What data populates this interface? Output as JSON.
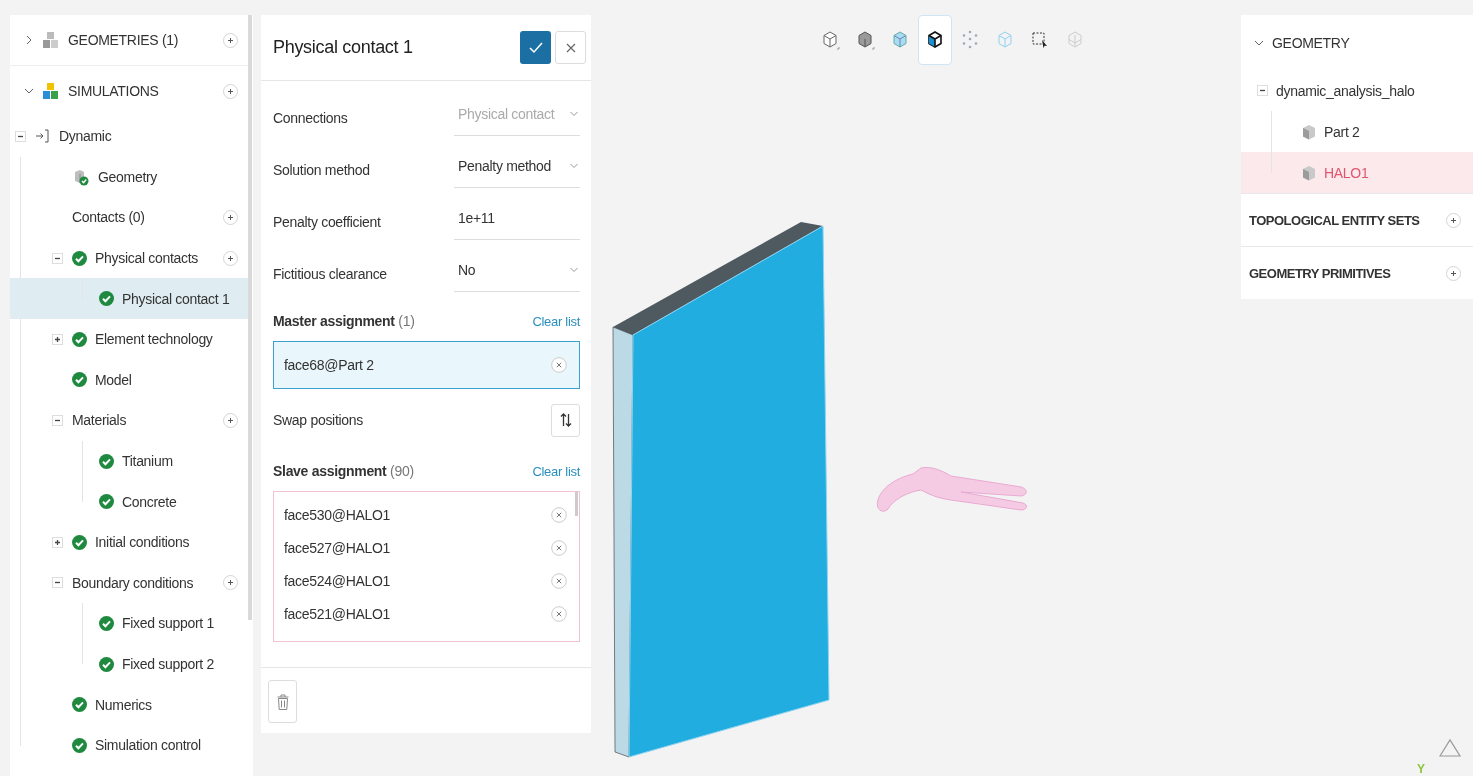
{
  "sidebar": {
    "sections": [
      {
        "label": "GEOMETRIES (1)",
        "kind": "geometries",
        "expanded": false,
        "add": true
      },
      {
        "label": "SIMULATIONS",
        "kind": "simulations",
        "expanded": true,
        "add": true,
        "children": [
          {
            "label": "Dynamic",
            "kind": "simulation",
            "expanded": true,
            "add": false,
            "selected": false,
            "children": [
              {
                "label": "Geometry",
                "kind": "geometry",
                "add": false,
                "selected": false
              },
              {
                "label": "Contacts (0)",
                "kind": "plain",
                "add": true,
                "selected": false
              },
              {
                "label": "Physical contacts",
                "kind": "check",
                "expanded": true,
                "add": true,
                "selected": false,
                "children": [
                  {
                    "label": "Physical contact 1",
                    "kind": "check",
                    "add": false,
                    "selected": true
                  }
                ]
              },
              {
                "label": "Element technology",
                "kind": "check",
                "expanded": false,
                "add": false,
                "selected": false
              },
              {
                "label": "Model",
                "kind": "check",
                "add": false,
                "selected": false
              },
              {
                "label": "Materials",
                "kind": "plain",
                "expanded": true,
                "add": true,
                "selected": false,
                "children": [
                  {
                    "label": "Titanium",
                    "kind": "check",
                    "add": false,
                    "selected": false
                  },
                  {
                    "label": "Concrete",
                    "kind": "check",
                    "add": false,
                    "selected": false
                  }
                ]
              },
              {
                "label": "Initial conditions",
                "kind": "check",
                "expanded": false,
                "add": false,
                "selected": false
              },
              {
                "label": "Boundary conditions",
                "kind": "plain",
                "expanded": true,
                "add": true,
                "selected": false,
                "children": [
                  {
                    "label": "Fixed support 1",
                    "kind": "check",
                    "add": false,
                    "selected": false
                  },
                  {
                    "label": "Fixed support 2",
                    "kind": "check",
                    "add": false,
                    "selected": false
                  }
                ]
              },
              {
                "label": "Numerics",
                "kind": "check",
                "add": false,
                "selected": false
              },
              {
                "label": "Simulation control",
                "kind": "check",
                "add": false,
                "selected": false
              }
            ]
          }
        ]
      }
    ]
  },
  "panel": {
    "title": "Physical contact 1",
    "fields": [
      {
        "label": "Connections",
        "value": "Physical contact",
        "kind": "select",
        "disabled": true
      },
      {
        "label": "Solution method",
        "value": "Penalty method",
        "kind": "select",
        "disabled": false
      },
      {
        "label": "Penalty coefficient",
        "value": "1e+11",
        "kind": "input",
        "disabled": false
      },
      {
        "label": "Fictitious clearance",
        "value": "No",
        "kind": "select",
        "disabled": false
      }
    ],
    "master": {
      "title": "Master assignment",
      "count": "(1)",
      "clear": "Clear list",
      "active": true,
      "items": [
        "face68@Part 2"
      ]
    },
    "swap_label": "Swap positions",
    "slave": {
      "title": "Slave assignment",
      "count": "(90)",
      "clear": "Clear list",
      "active": false,
      "items": [
        "face530@HALO1",
        "face527@HALO1",
        "face524@HALO1",
        "face521@HALO1"
      ]
    }
  },
  "toolbar": {
    "tools": [
      {
        "kind": "outline-corner",
        "selected": false
      },
      {
        "kind": "solid-corner",
        "selected": false
      },
      {
        "kind": "shaded",
        "selected": false
      },
      {
        "kind": "shaded-edges",
        "selected": true
      },
      {
        "kind": "points",
        "selected": false
      },
      {
        "kind": "wireframe",
        "selected": false
      },
      {
        "kind": "box-select",
        "selected": false
      },
      {
        "kind": "transparent",
        "selected": false
      }
    ]
  },
  "model_tree": {
    "title": "GEOMETRY",
    "expanded": true,
    "items": [
      {
        "label": "dynamic_analysis_halo",
        "expanded": true,
        "selected": false,
        "children": [
          {
            "label": "Part 2",
            "kind": "part",
            "selected": false
          },
          {
            "label": "HALO1",
            "kind": "part",
            "selected": true
          }
        ]
      }
    ],
    "sections": [
      {
        "label": "TOPOLOGICAL ENTITY SETS",
        "add": true
      },
      {
        "label": "GEOMETRY PRIMITIVES",
        "add": true
      }
    ]
  },
  "viewport": {
    "axis_label": "Y"
  }
}
